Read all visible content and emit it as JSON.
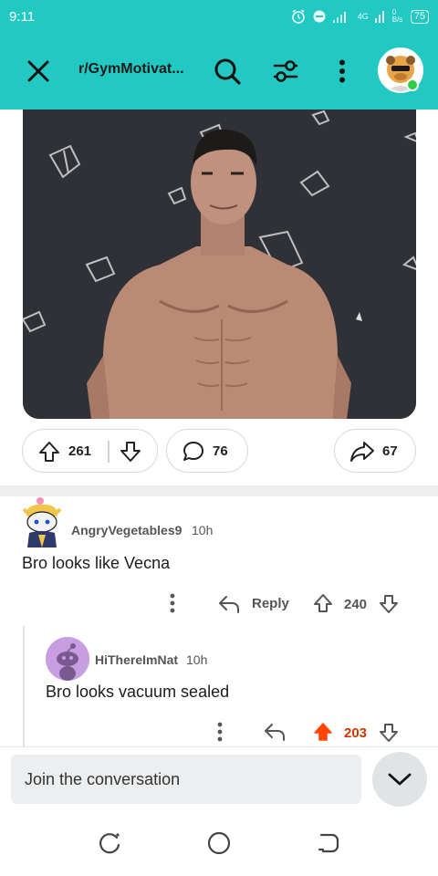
{
  "status": {
    "time": "9:11",
    "network": "4G",
    "speed": "0\nB/s",
    "battery": "75"
  },
  "header": {
    "subreddit": "r/GymMotivat..."
  },
  "post": {
    "upvotes": "261",
    "comments": "76",
    "shares": "67"
  },
  "comments": [
    {
      "author": "AngryVegetables9",
      "time": "10h",
      "body": "Bro looks like Vecna",
      "reply_label": "Reply",
      "score": "240"
    },
    {
      "author": "HiThereImNat",
      "time": "10h",
      "body": "Bro looks vacuum sealed",
      "score": "203"
    }
  ],
  "composer": {
    "placeholder": "Join the conversation"
  },
  "colors": {
    "header_bg": "#22c9c2",
    "upvote_active": "#ff4500",
    "score_active": "#cc3700"
  }
}
